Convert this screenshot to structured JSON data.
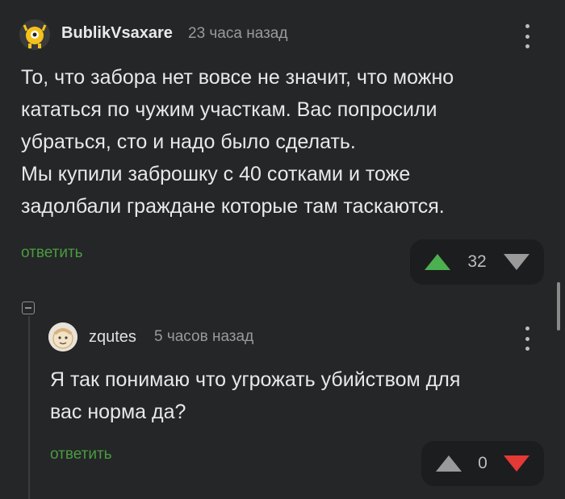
{
  "comments": [
    {
      "username": "BublikVsaxare",
      "time": "23 часа назад",
      "text": "То, что забора нет вовсе не значит, что можно\nкататься по чужим участкам. Вас попросили\nубраться, сто и надо было сделать.\nМы купили заброшку с 40 сотками и тоже\nзадолбали граждане которые там таскаются.",
      "reply_label": "ответить",
      "votes": "32",
      "upvote_color": "#4caf50",
      "downvote_color": "#9a9a9a",
      "avatar_icon": "yellow-character-avatar"
    },
    {
      "username": "zqutes",
      "time": "5 часов назад",
      "text": "Я так понимаю что угрожать убийством для\nвас норма да?",
      "reply_label": "ответить",
      "votes": "0",
      "upvote_color": "#9a9a9a",
      "downvote_color": "#e53935",
      "avatar_icon": "cartoon-face-avatar"
    }
  ],
  "colors": {
    "background": "#242628",
    "accent_green": "#4b9b3f",
    "downvote_red": "#e53935"
  }
}
